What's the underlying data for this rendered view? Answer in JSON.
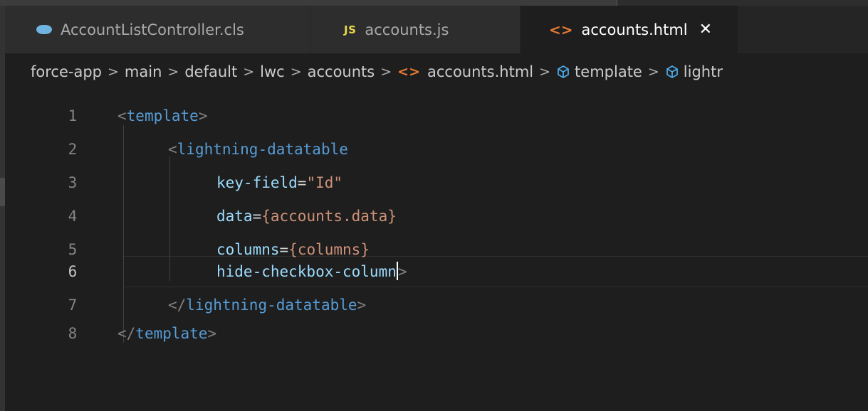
{
  "tabs": [
    {
      "label": "AccountListController.cls",
      "icon": "salesforce-cloud-icon",
      "active": false
    },
    {
      "label": "accounts.js",
      "icon": "js-icon",
      "icon_text": "JS",
      "active": false
    },
    {
      "label": "accounts.html",
      "icon": "html-brackets-icon",
      "icon_text": "<>",
      "active": true,
      "close": "✕"
    }
  ],
  "breadcrumb": {
    "items": [
      "force-app",
      "main",
      "default",
      "lwc",
      "accounts",
      "accounts.html",
      "template",
      "lightr"
    ],
    "separator": ">"
  },
  "editor": {
    "current_line": 6,
    "lines": [
      {
        "number": "1",
        "open": "<",
        "tag": "template",
        "close": ">"
      },
      {
        "number": "2",
        "open": "<",
        "tag": "lightning-datatable"
      },
      {
        "number": "3",
        "attr": "key-field",
        "eq": "=",
        "value": "\"Id\""
      },
      {
        "number": "4",
        "attr": "data",
        "eq": "=",
        "value": "{accounts.data}"
      },
      {
        "number": "5",
        "attr": "columns",
        "eq": "=",
        "value": "{columns}"
      },
      {
        "number": "6",
        "attr": "hide-checkbox-column",
        "close": ">"
      },
      {
        "number": "7",
        "open": "</",
        "tag": "lightning-datatable",
        "close": ">"
      },
      {
        "number": "8",
        "open": "</",
        "tag": "template",
        "close": ">"
      }
    ]
  },
  "colors": {
    "background": "#1e1e1e",
    "tag": "#569cd6",
    "attribute": "#9cdcfe",
    "string": "#ce9178",
    "html_icon": "#e37933",
    "js_icon": "#e8d44d"
  }
}
